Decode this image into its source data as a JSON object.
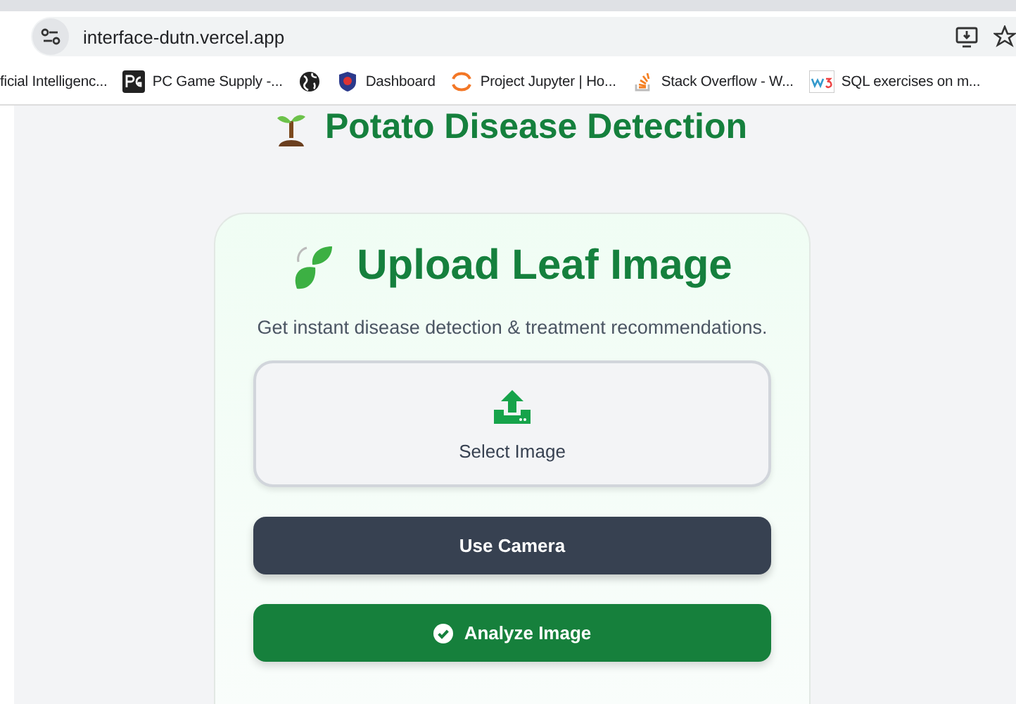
{
  "browser": {
    "url": "interface-dutn.vercel.app"
  },
  "bookmarks": [
    {
      "kind": "text",
      "label": "ficial Intelligenc..."
    },
    {
      "kind": "text",
      "label": "PC Game Supply -..."
    },
    {
      "kind": "icon"
    },
    {
      "kind": "text",
      "label": "Dashboard"
    },
    {
      "kind": "text",
      "label": "Project Jupyter | Ho..."
    },
    {
      "kind": "text",
      "label": "Stack Overflow - W..."
    },
    {
      "kind": "text",
      "label": "SQL exercises on m..."
    }
  ],
  "page": {
    "title": "Potato Disease Detection"
  },
  "card": {
    "heading": "Upload Leaf Image",
    "subtitle": "Get instant disease detection & treatment recommendations.",
    "buttons": [
      {
        "kind": "upload",
        "label": "Select Image"
      },
      {
        "kind": "dark",
        "label": "Use Camera"
      },
      {
        "kind": "primary",
        "label": "Analyze Image"
      }
    ]
  }
}
